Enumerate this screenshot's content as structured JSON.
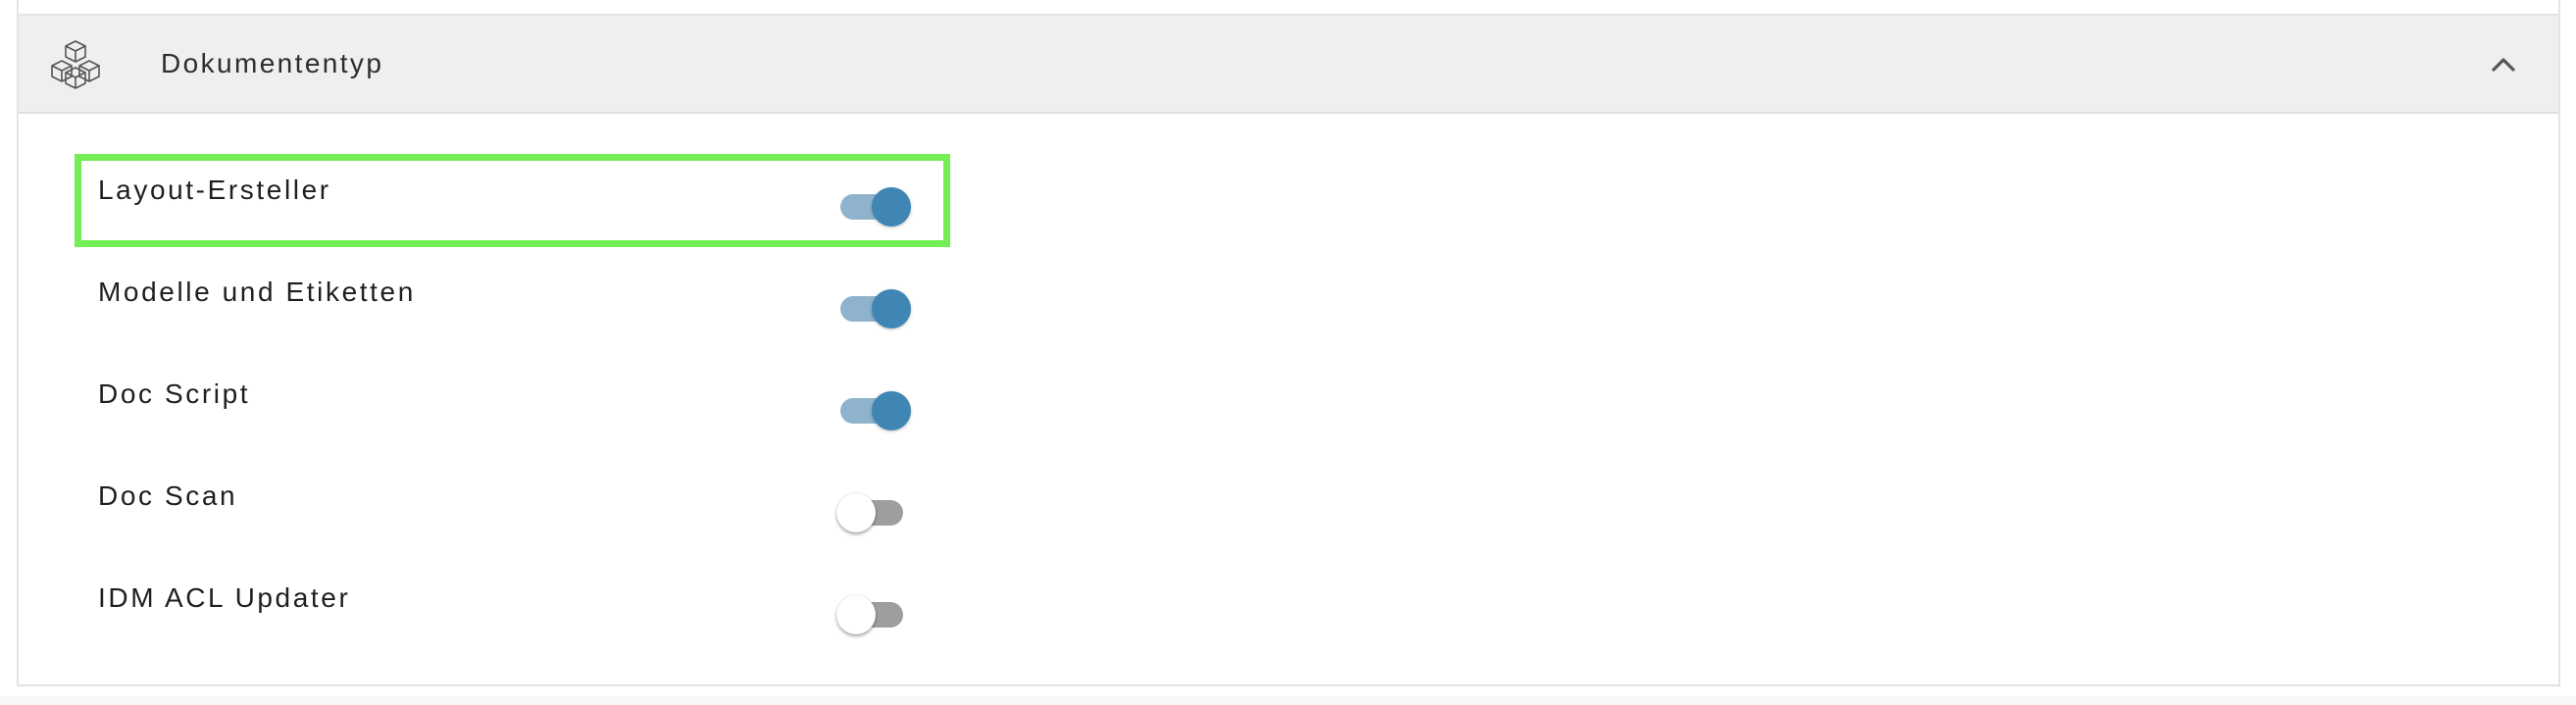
{
  "section": {
    "title": "Dokumententyp",
    "icon": "cubes-icon",
    "collapse_icon": "chevron-up-icon",
    "expanded": true
  },
  "items": [
    {
      "label": "Layout-Ersteller",
      "enabled": true,
      "highlighted": true
    },
    {
      "label": "Modelle und Etiketten",
      "enabled": true
    },
    {
      "label": "Doc Script",
      "enabled": true
    },
    {
      "label": "Doc Scan",
      "enabled": false
    },
    {
      "label": "IDM ACL Updater",
      "enabled": false
    }
  ],
  "colors": {
    "toggle_on_knob": "#3f86b4",
    "toggle_on_track": "#8fb3cc",
    "toggle_off_track": "#9e9e9e",
    "highlight": "#74ee55",
    "header_bg": "#efefef"
  }
}
